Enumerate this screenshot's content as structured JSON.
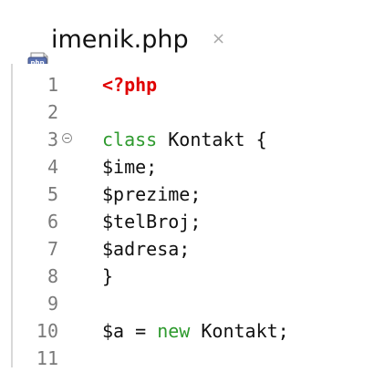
{
  "tab": {
    "title": "imenik.php",
    "close_glyph": "×",
    "icon": "php-file-icon"
  },
  "editor": {
    "lines": [
      {
        "number": "1",
        "tokens": [
          {
            "type": "php-open",
            "text": "<?php"
          }
        ]
      },
      {
        "number": "2",
        "tokens": []
      },
      {
        "number": "3",
        "fold": true,
        "tokens": [
          {
            "type": "kw",
            "text": "class"
          },
          {
            "type": "plain",
            "text": " Kontakt {"
          }
        ]
      },
      {
        "number": "4",
        "tokens": [
          {
            "type": "plain",
            "text": "$ime;"
          }
        ]
      },
      {
        "number": "5",
        "tokens": [
          {
            "type": "plain",
            "text": "$prezime;"
          }
        ]
      },
      {
        "number": "6",
        "tokens": [
          {
            "type": "plain",
            "text": "$telBroj;"
          }
        ]
      },
      {
        "number": "7",
        "tokens": [
          {
            "type": "plain",
            "text": "$adresa;"
          }
        ]
      },
      {
        "number": "8",
        "tokens": [
          {
            "type": "plain",
            "text": "}"
          }
        ]
      },
      {
        "number": "9",
        "tokens": []
      },
      {
        "number": "10",
        "tokens": [
          {
            "type": "plain",
            "text": "$a = "
          },
          {
            "type": "kw",
            "text": "new"
          },
          {
            "type": "plain",
            "text": " Kontakt;"
          }
        ]
      },
      {
        "number": "11",
        "tokens": []
      }
    ]
  },
  "colors": {
    "php_open": "#e00000",
    "keyword": "#2e9a2e",
    "text": "#111111",
    "line_number": "#7a7a7a"
  }
}
